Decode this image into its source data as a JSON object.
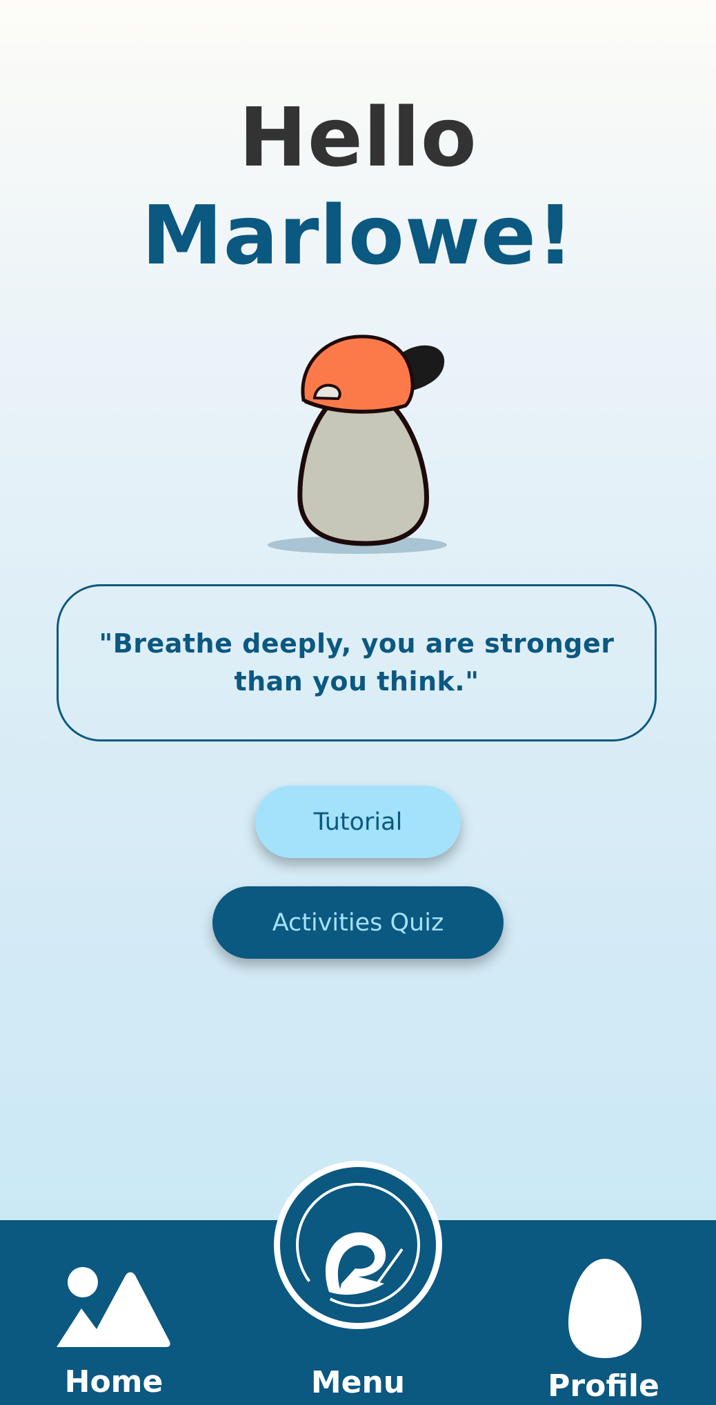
{
  "greeting": {
    "hello": "Hello",
    "name": "Marlowe!"
  },
  "mascot": {
    "icon": "egg-mascot-with-cap-icon",
    "cap_color": "#fc7a4a",
    "body_color": "#c6c7b8"
  },
  "quote": {
    "text": "\"Breathe deeply, you are stronger than you think.\""
  },
  "buttons": {
    "tutorial": "Tutorial",
    "activities_quiz": "Activities Quiz"
  },
  "nav": {
    "home": {
      "label": "Home",
      "icon": "mountain-icon"
    },
    "menu": {
      "label": "Menu",
      "icon": "app-logo-icon"
    },
    "profile": {
      "label": "Profile",
      "icon": "egg-icon"
    }
  },
  "colors": {
    "primary": "#0b5881",
    "accent_light": "#a4e2fb",
    "text_dark": "#333333"
  }
}
